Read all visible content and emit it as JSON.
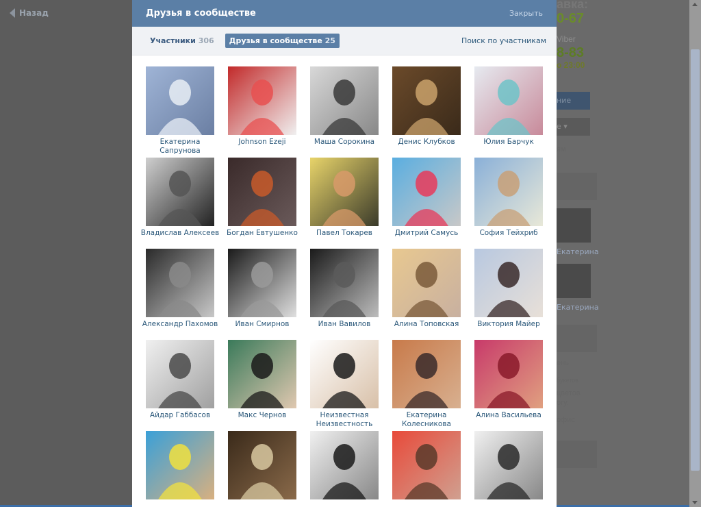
{
  "background": {
    "back_label": "Назад",
    "top_text": "авка:",
    "phone1_prefix": "",
    "phone1": "0-67",
    "viber": "Viber",
    "phone2": "8-83",
    "hours": "о 23:00",
    "btn1": "ние",
    "btn2": "е ▾",
    "small1": "ям",
    "names": [
      "Екатерина",
      "Екатерина"
    ],
    "lines": [
      "ень",
      "букетов",
      "цветов",
      "огу.",
      "офис"
    ]
  },
  "modal": {
    "title": "Друзья в сообществе",
    "close_label": "Закрыть",
    "tabs": [
      {
        "label": "Участники",
        "count": "306"
      },
      {
        "label": "Друзья в сообществе",
        "count": "25"
      }
    ],
    "search_label": "Поиск по участникам"
  },
  "friends": [
    {
      "name": "Екатерина Сапрунова"
    },
    {
      "name": "Johnson Ezeji"
    },
    {
      "name": "Маша Сорокина"
    },
    {
      "name": "Денис Клубков"
    },
    {
      "name": "Юлия Барчук"
    },
    {
      "name": "Владислав Алексеев"
    },
    {
      "name": "Богдан Евтушенко"
    },
    {
      "name": "Павел Токарев"
    },
    {
      "name": "Дмитрий Самусь"
    },
    {
      "name": "София Тейхриб"
    },
    {
      "name": "Александр Пахомов"
    },
    {
      "name": "Иван Смирнов"
    },
    {
      "name": "Иван Вавилов"
    },
    {
      "name": "Алина Топовская"
    },
    {
      "name": "Виктория Майер"
    },
    {
      "name": "Айдар Габбасов"
    },
    {
      "name": "Макс Чернов"
    },
    {
      "name": "Неизвестная Неизвестность"
    },
    {
      "name": "Екатерина Колесникова"
    },
    {
      "name": "Алина Васильева"
    },
    {
      "name": ""
    },
    {
      "name": ""
    },
    {
      "name": ""
    },
    {
      "name": ""
    },
    {
      "name": ""
    }
  ],
  "photo_colors": [
    [
      "#9fb4d6",
      "#e8edf5",
      "#6b7fa3"
    ],
    [
      "#c22a2a",
      "#e85050",
      "#f0f0f0"
    ],
    [
      "#d8d8d8",
      "#3a3a3a",
      "#888"
    ],
    [
      "#6b4a2a",
      "#caa26b",
      "#3a2a1a"
    ],
    [
      "#e6eaf0",
      "#6fc3c8",
      "#c88a9a"
    ],
    [
      "#cfcfcf",
      "#555",
      "#222"
    ],
    [
      "#3a2a2a",
      "#c85a2a",
      "#6a5a5a"
    ],
    [
      "#e8d46a",
      "#d89a6a",
      "#3a3a2a"
    ],
    [
      "#5aaee0",
      "#e83a5a",
      "#c8c8c8"
    ],
    [
      "#8ab0d8",
      "#c8a078",
      "#e8e8d8"
    ],
    [
      "#2a2a2a",
      "#8a8a8a",
      "#c8c8c8"
    ],
    [
      "#1a1a1a",
      "#9a9a9a",
      "#e0e0e0"
    ],
    [
      "#1a1a1a",
      "#5a5a5a",
      "#bdbdbd"
    ],
    [
      "#e8c890",
      "#7a5a3a",
      "#c8b0a0"
    ],
    [
      "#b8c8e0",
      "#3a2a2a",
      "#e8e0d8"
    ],
    [
      "#f0f0f0",
      "#4a4a4a",
      "#a0a0a0"
    ],
    [
      "#3a7a5a",
      "#1a1a1a",
      "#e0c8b0"
    ],
    [
      "#ffffff",
      "#1a1a1a",
      "#d8c0a8"
    ],
    [
      "#c87a4a",
      "#3a2a2a",
      "#d8b090"
    ],
    [
      "#c83a6a",
      "#8a1a2a",
      "#e0a080"
    ],
    [
      "#3aa0d8",
      "#f0e040",
      "#d8b080"
    ],
    [
      "#3a2a1a",
      "#d8c8a0",
      "#8a6a4a"
    ],
    [
      "#f0f0f0",
      "#1a1a1a",
      "#888"
    ],
    [
      "#e84a3a",
      "#5a3a2a",
      "#d0a090"
    ],
    [
      "#f0f0f0",
      "#2a2a2a",
      "#888"
    ]
  ]
}
